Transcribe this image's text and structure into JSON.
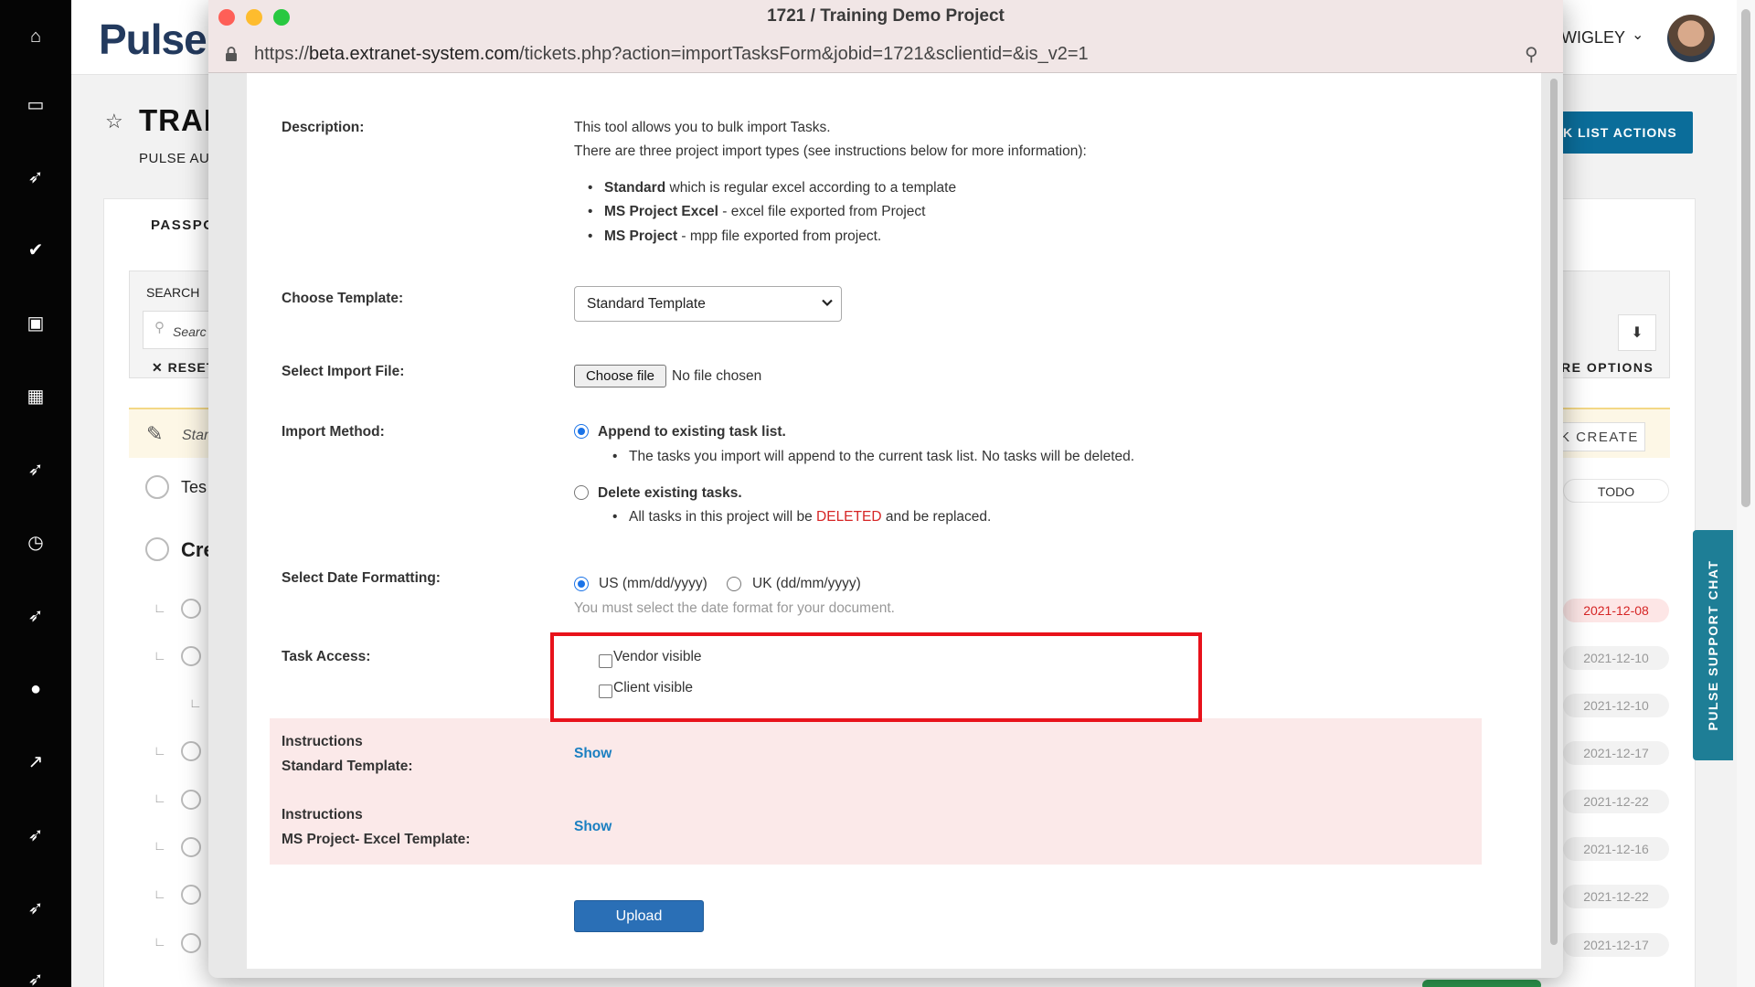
{
  "app": {
    "logo": "Pulse",
    "user_name": "WIGLEY",
    "rail_icons": [
      "home-icon",
      "inbox-icon",
      "rocket-icon",
      "check-circle-icon",
      "image-icon",
      "calendar-icon",
      "rocket-icon",
      "clock-icon",
      "rocket-icon",
      "user-icon",
      "chart-icon",
      "rocket-icon",
      "rocket-icon",
      "rocket-icon"
    ],
    "page_title": "TRAII",
    "page_subtitle": "PULSE AU:",
    "task_list_actions": "K LIST ACTIONS",
    "tab_passport": "PASSPO",
    "search_label": "SEARCH",
    "search_placeholder": "Searc",
    "reset_label": "RESET",
    "more_options": "RE OPTIONS",
    "quick_placeholder": "Star",
    "quick_create": "K CREATE",
    "row1_text": "Tes",
    "row2_text": "Cre",
    "todo_label": "TODO",
    "dates": [
      "2021-12-08",
      "2021-12-10",
      "2021-12-10",
      "2021-12-17",
      "2021-12-22",
      "2021-12-16",
      "2021-12-22",
      "2021-12-17"
    ],
    "support_chat": "PULSE SUPPORT CHAT"
  },
  "window": {
    "title": "1721 / Training Demo Project",
    "url_prefix": "https://",
    "url_host": "beta.extranet-system.com",
    "url_path": "/tickets.php?action=importTasksForm&jobid=1721&sclientid=&is_v2=1"
  },
  "form": {
    "description_label": "Description:",
    "description_line1": "This tool allows you to bulk import Tasks.",
    "description_line2": "There are three project import types (see instructions below for more information):",
    "types": [
      {
        "name": "Standard",
        "desc": " which is regular excel according to a template"
      },
      {
        "name": "MS Project Excel",
        "desc": " - excel file exported from Project"
      },
      {
        "name": "MS Project",
        "desc": " - mpp file exported from project."
      }
    ],
    "template_label": "Choose Template:",
    "template_value": "Standard Template",
    "import_file_label": "Select Import File:",
    "choose_file": "Choose file",
    "no_file": "No file chosen",
    "import_method_label": "Import Method:",
    "append_label": "Append to existing task list.",
    "append_note": "The tasks you import will append to the current task list. No tasks will be deleted.",
    "delete_label": "Delete existing tasks.",
    "delete_note_a": "All tasks in this project will be ",
    "delete_note_b": "DELETED",
    "delete_note_c": " and be replaced.",
    "date_label": "Select Date Formatting:",
    "date_us": "US (mm/dd/yyyy)",
    "date_uk": "UK (dd/mm/yyyy)",
    "date_hint": "You must select the date format for your document.",
    "access_label": "Task Access:",
    "vendor_visible": "Vendor visible",
    "client_visible": "Client visible",
    "instructions1_a": "Instructions",
    "instructions1_b": "Standard Template:",
    "instructions2_a": "Instructions",
    "instructions2_b": "MS Project- Excel Template:",
    "show": "Show",
    "upload": "Upload"
  },
  "colors": {
    "accent": "#0b6d9a",
    "highlight": "#e8121b",
    "link": "#1a7fc1",
    "upload": "#2a6fb6",
    "deleted": "#d62525"
  }
}
